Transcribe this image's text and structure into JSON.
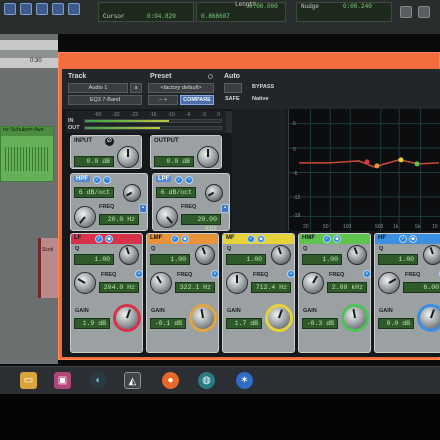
{
  "daw": {
    "cursor_label": "Cursor",
    "length_label": "Length",
    "nudge_label": "Nudge",
    "counter_main": "0:04.829",
    "counter_cursor": "0.868607",
    "counter_length": "0:00.000",
    "counter_nudge": "0:00.240",
    "ruler_time": "0:30",
    "clip_name": "nz-Schubert-Ave",
    "track_partial_label": "Scrol"
  },
  "plugin": {
    "track_label": "Track",
    "preset_label": "Preset",
    "auto_label": "Auto",
    "track_name": "Audio 1",
    "track_slot": "a",
    "plugin_name": "EQ3 7-Band",
    "preset_name": "<factory default>",
    "minus_plus": "−  +",
    "compare": "COMPARE",
    "bypass": "BYPASS",
    "safe": "SAFE",
    "native": "Native"
  },
  "meters": {
    "in_label": "IN",
    "out_label": "OUT",
    "scale": [
      "-60",
      "-32",
      "-22",
      "-16",
      "-10",
      "-6",
      "-3",
      "0"
    ],
    "in_level": 0.62,
    "out_level": 0.55
  },
  "io": {
    "input_label": "INPUT",
    "input_value": "0.0 dB",
    "output_label": "OUTPUT",
    "output_value": "0.0 dB",
    "phase_symbol": "Ø"
  },
  "hpf": {
    "label": "HPF",
    "slope": "6 dB/oct",
    "freq_label": "FREQ",
    "freq": "20.0 Hz"
  },
  "lpf": {
    "label": "LPF",
    "slope": "6 dB/oct",
    "freq_label": "FREQ",
    "freq": "20.00 kHz"
  },
  "graph": {
    "y_scale": [
      "6",
      "0",
      "-6",
      "-12",
      "-18"
    ],
    "x_scale": [
      "20",
      "50",
      "100",
      "500",
      "1k",
      "5k",
      "10"
    ],
    "curve_color": "#c94a3a"
  },
  "bands": [
    {
      "name": "LF",
      "color": "#d8324a",
      "q_label": "Q",
      "q": "1.00",
      "freq_label": "FREQ",
      "freq": "204.0 Hz",
      "gain_label": "GAIN",
      "gain": "1.9 dB",
      "gain_knob_color": "#d8324a"
    },
    {
      "name": "LMF",
      "color": "#e8923a",
      "q_label": "Q",
      "q": "1.00",
      "freq_label": "FREQ",
      "freq": "322.1 Hz",
      "gain_label": "GAIN",
      "gain": "-0.1 dB",
      "gain_knob_color": "#e0a640"
    },
    {
      "name": "MF",
      "color": "#e6d33a",
      "q_label": "Q",
      "q": "1.00",
      "freq_label": "FREQ",
      "freq": "712.4 Hz",
      "gain_label": "GAIN",
      "gain": "1.7 dB",
      "gain_knob_color": "#e6d33a"
    },
    {
      "name": "HMF",
      "color": "#5ec44e",
      "q_label": "Q",
      "q": "1.00",
      "freq_label": "FREQ",
      "freq": "2.00 kHz",
      "gain_label": "GAIN",
      "gain": "-0.3 dB",
      "gain_knob_color": "#4ec25a"
    },
    {
      "name": "HF",
      "color": "#3a8fe0",
      "q_label": "Q",
      "q": "1.00",
      "freq_label": "FREQ",
      "freq": "6.00",
      "gain_label": "GAIN",
      "gain": "0.0 dB",
      "gain_knob_color": "#3a8fe0"
    }
  ],
  "taskbar": {
    "icons": [
      "file-explorer-icon",
      "photo-icon",
      "app-round-icon",
      "pro-tools-icon",
      "firefox-icon",
      "globe-app-icon",
      "blue-app-icon"
    ]
  }
}
